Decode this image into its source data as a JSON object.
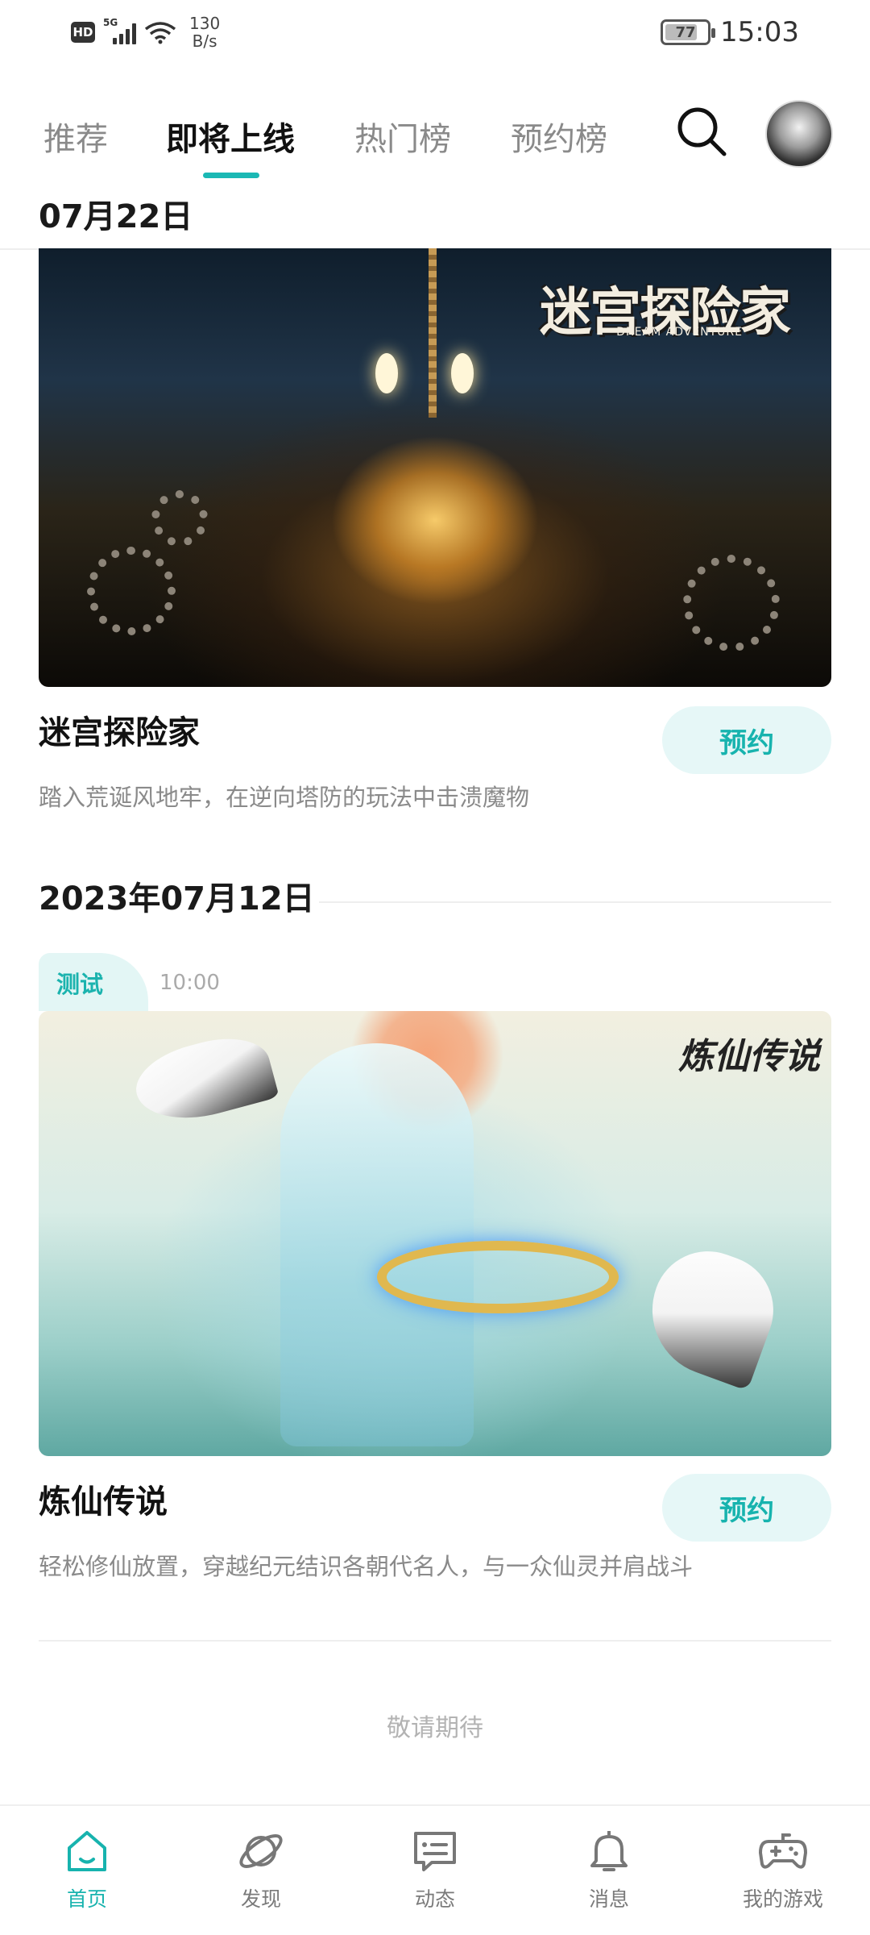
{
  "status_bar": {
    "hd": "HD",
    "network": "5G",
    "speed_value": "130",
    "speed_unit": "B/s",
    "battery": "77",
    "battery_level": 0.77,
    "time": "15:03"
  },
  "top_nav": {
    "tabs": [
      {
        "label": "推荐",
        "active": false
      },
      {
        "label": "即将上线",
        "active": true
      },
      {
        "label": "热门榜",
        "active": false
      },
      {
        "label": "预约榜",
        "active": false
      }
    ],
    "search_icon": "search-icon",
    "avatar": "user-avatar"
  },
  "sections": [
    {
      "date": "07月22日",
      "game": {
        "logo": "迷宫探险家",
        "logo_sub": "DREAM ADVENTURE",
        "title": "迷宫探险家",
        "description": "踏入荒诞风地牢，在逆向塔防的玩法中击溃魔物",
        "button": "预约"
      }
    },
    {
      "date": "2023年07月12日",
      "game": {
        "tag": "测试",
        "time": "10:00",
        "logo": "炼仙传说",
        "title": "炼仙传说",
        "description": "轻松修仙放置，穿越纪元结识各朝代名人，与一众仙灵并肩战斗",
        "button": "预约"
      }
    }
  ],
  "footer_text": "敬请期待",
  "bottom_nav": [
    {
      "label": "首页",
      "icon": "home-icon",
      "active": true
    },
    {
      "label": "发现",
      "icon": "planet-icon",
      "active": false
    },
    {
      "label": "动态",
      "icon": "chat-icon",
      "active": false
    },
    {
      "label": "消息",
      "icon": "bell-icon",
      "active": false
    },
    {
      "label": "我的游戏",
      "icon": "gamepad-icon",
      "active": false
    }
  ],
  "colors": {
    "accent": "#17b3ae",
    "accent_bg": "#e6f7f7",
    "text_primary": "#111111",
    "text_secondary": "#8a8a8a"
  }
}
